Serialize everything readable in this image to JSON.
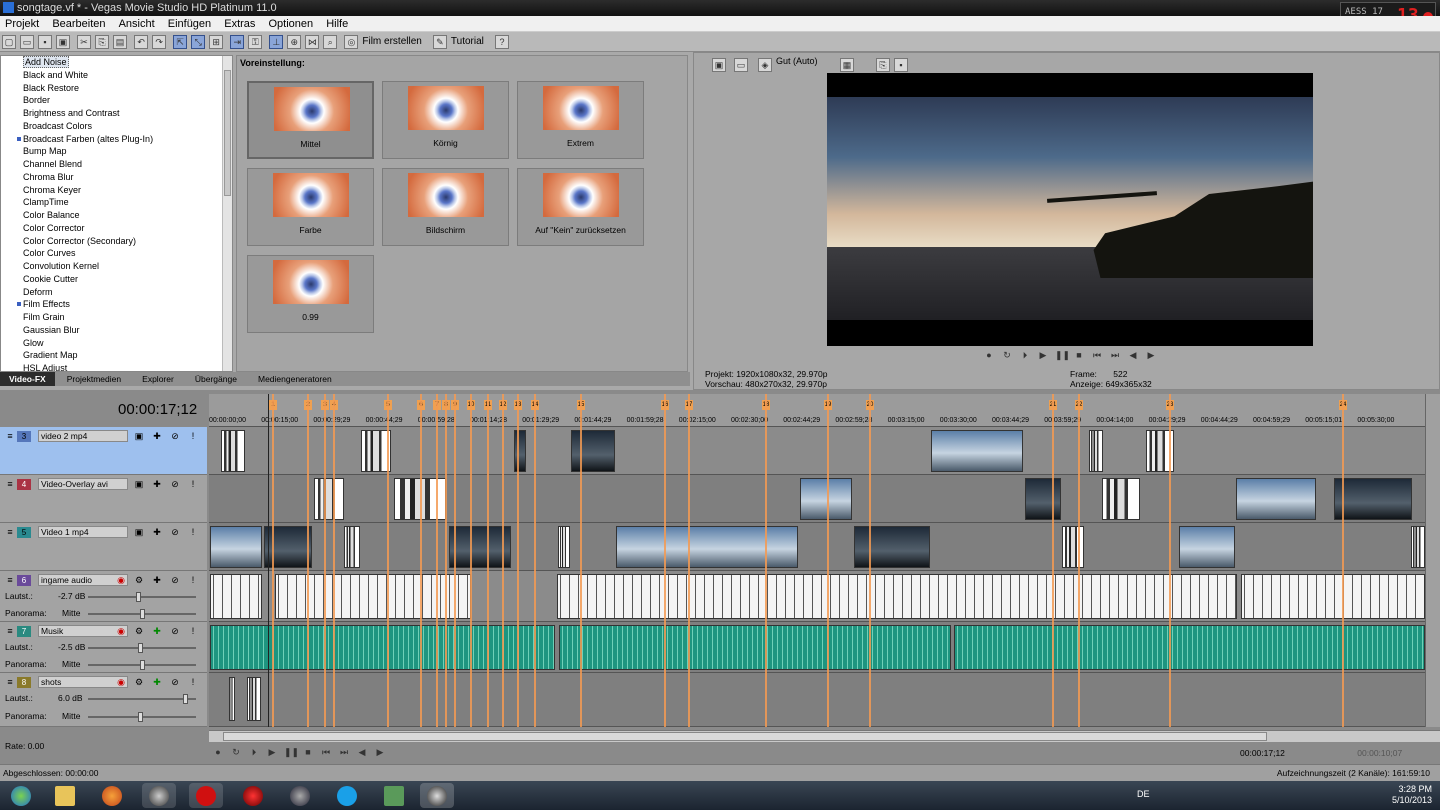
{
  "window": {
    "title": "songtage.vf * - Vegas Movie Studio HD Platinum 11.0"
  },
  "recorder": {
    "fps": "AESS 17",
    "count": "13"
  },
  "menu": [
    "Projekt",
    "Bearbeiten",
    "Ansicht",
    "Einfügen",
    "Extras",
    "Optionen",
    "Hilfe"
  ],
  "toolbar": {
    "film_label": "Film erstellen",
    "tutorial_label": "Tutorial"
  },
  "fx_list": {
    "items": [
      "Add Noise",
      "Black and White",
      "Black Restore",
      "Border",
      "Brightness and Contrast",
      "Broadcast Colors",
      "Broadcast Farben (altes Plug-In)",
      "Bump Map",
      "Channel Blend",
      "Chroma Blur",
      "Chroma Keyer",
      "ClampTime",
      "Color Balance",
      "Color Corrector",
      "Color Corrector (Secondary)",
      "Color Curves",
      "Convolution Kernel",
      "Cookie Cutter",
      "Deform",
      "Film Effects",
      "Film Grain",
      "Gaussian Blur",
      "Glow",
      "Gradient Map",
      "HSL Adjust"
    ],
    "selected": "Add Noise"
  },
  "presets": {
    "header": "Voreinstellung:",
    "items": [
      "Mittel",
      "Körnig",
      "Extrem",
      "Farbe",
      "Bildschirm",
      "Auf \"Kein\" zurücksetzen",
      "0.99"
    ]
  },
  "tabs": [
    "Video-FX",
    "Projektmedien",
    "Explorer",
    "Übergänge",
    "Mediengeneratoren"
  ],
  "preview": {
    "quality": "Gut (Auto)",
    "projekt_label": "Projekt:",
    "projekt_value": "1920x1080x32, 29.970p",
    "vorschau_label": "Vorschau:",
    "vorschau_value": "480x270x32, 29.970p",
    "frame_label": "Frame:",
    "frame_value": "522",
    "anzeige_label": "Anzeige:",
    "anzeige_value": "649x365x32"
  },
  "timeline": {
    "timecode": "00:00:17;12",
    "ruler": [
      "00:00:00;00",
      "00:00:15;00",
      "00:00:29;29",
      "00:00:44;29",
      "00:00:59;28",
      "00:01:14;28",
      "00:01:29;29",
      "00:01:44;29",
      "00:01:59;28",
      "00:02:15;00",
      "00:02:30;00",
      "00:02:44;29",
      "00:02:59;28",
      "00:03:15;00",
      "00:03:30;00",
      "00:03:44;29",
      "00:03:59;29",
      "00:04:14;00",
      "00:04:29;29",
      "00:04:44;29",
      "00:04:59;29",
      "00:05:15;01",
      "00:05:30;00"
    ],
    "markers": [
      "1",
      "2",
      "3",
      "4",
      "5",
      "6",
      "7",
      "8",
      "9",
      "10",
      "11",
      "12",
      "13",
      "14",
      "15",
      "16",
      "17",
      "18",
      "19",
      "20",
      "21",
      "22",
      "23",
      "24"
    ],
    "tracks": [
      {
        "num": "3",
        "name": "video 2 mp4",
        "color": "#5577bb"
      },
      {
        "num": "4",
        "name": "Video-Overlay avi",
        "color": "#aa3344"
      },
      {
        "num": "5",
        "name": "Video 1 mp4",
        "color": "#2a8a90"
      },
      {
        "num": "6",
        "name": "ingame audio",
        "color": "#6a4a9a",
        "vol_label": "Lautst.:",
        "vol": "-2.7 dB",
        "pan_label": "Panorama:",
        "pan": "Mitte"
      },
      {
        "num": "7",
        "name": "Musik",
        "color": "#2a8a80",
        "vol_label": "Lautst.:",
        "vol": "-2.5 dB",
        "pan_label": "Panorama:",
        "pan": "Mitte"
      },
      {
        "num": "8",
        "name": "shots",
        "color": "#8a7a2a",
        "vol_label": "Lautst.:",
        "vol": "6.0 dB",
        "pan_label": "Panorama:",
        "pan": "Mitte"
      }
    ],
    "rate": "Rate: 0.00",
    "bottom_tc1": "00:00:17;12",
    "bottom_tc2": "00:00:10;07"
  },
  "status": {
    "left": "Abgeschlossen: 00:00:00",
    "right": "Aufzeichnungszeit (2 Kanäle): 161:59:10"
  },
  "taskbar": {
    "lang": "DE",
    "time": "3:28 PM",
    "date": "5/10/2013"
  }
}
